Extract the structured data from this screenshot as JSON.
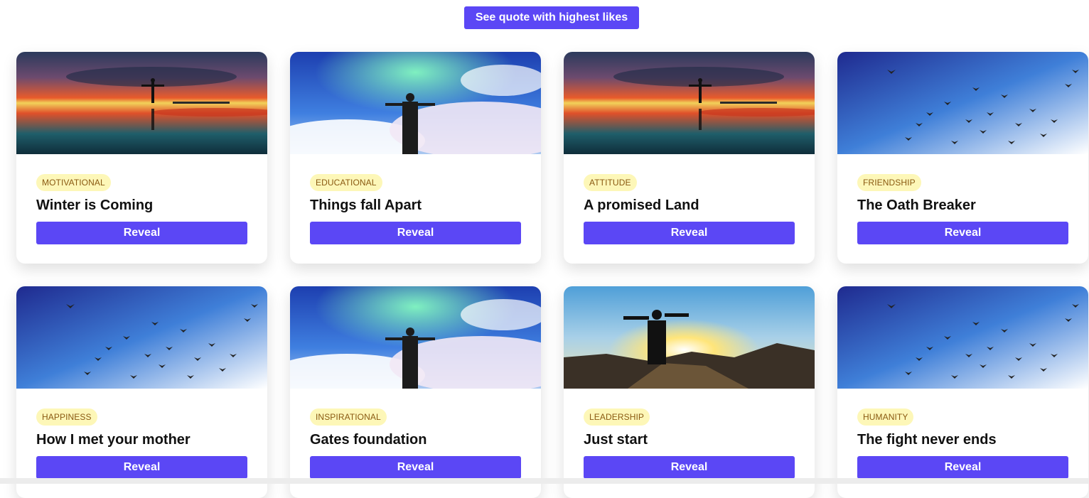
{
  "header": {
    "top_button_label": "See quote with highest likes"
  },
  "colors": {
    "accent": "#5b47f5",
    "tag_bg": "#fdf7b8",
    "tag_text": "#8a5a12"
  },
  "cards": [
    {
      "tag": "MOTIVATIONAL",
      "title": "Winter is Coming",
      "button": "Reveal",
      "image": "sunset-reflection-image"
    },
    {
      "tag": "EDUCATIONAL",
      "title": "Things fall Apart",
      "button": "Reveal",
      "image": "aurora-clouds-image"
    },
    {
      "tag": "ATTITUDE",
      "title": "A promised Land",
      "button": "Reveal",
      "image": "sunset-reflection-image"
    },
    {
      "tag": "FRIENDSHIP",
      "title": "The Oath Breaker",
      "button": "Reveal",
      "image": "birds-sky-image"
    },
    {
      "tag": "HAPPINESS",
      "title": "How I met your mother",
      "button": "Reveal",
      "image": "birds-sky-image"
    },
    {
      "tag": "INSPIRATIONAL",
      "title": "Gates foundation",
      "button": "Reveal",
      "image": "aurora-clouds-image"
    },
    {
      "tag": "LEADERSHIP",
      "title": "Just start",
      "button": "Reveal",
      "image": "mountain-sunrise-image"
    },
    {
      "tag": "HUMANITY",
      "title": "The fight never ends",
      "button": "Reveal",
      "image": "birds-sky-image"
    }
  ]
}
